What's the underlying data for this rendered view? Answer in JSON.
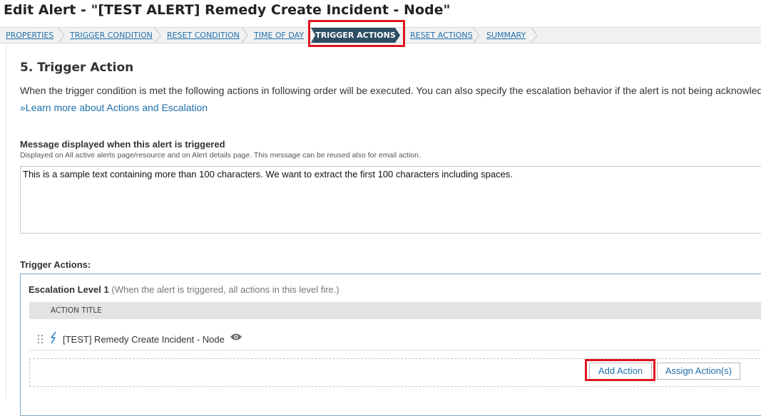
{
  "header": {
    "title": "Edit Alert - \"[TEST ALERT] Remedy Create Incident - Node\""
  },
  "wizard": {
    "steps": [
      "PROPERTIES",
      "TRIGGER CONDITION",
      "RESET CONDITION",
      "TIME OF DAY",
      "TRIGGER ACTIONS",
      "RESET ACTIONS",
      "SUMMARY"
    ],
    "active_step": "TRIGGER ACTIONS"
  },
  "section": {
    "title": "5. Trigger Action",
    "description": "When the trigger condition is met the following actions in following order will be executed. You can also specify the escalation behavior if the alert is not being acknowledged",
    "learn_more_link": "»Learn more about Actions and Escalation"
  },
  "message": {
    "label": "Message displayed when this alert is triggered",
    "help": "Displayed on All active alerts page/resource and on Alert details page. This message can be reused also for email action.",
    "value": "This is a sample text containing more than 100 characters. We want to extract the first 100 characters including spaces."
  },
  "trigger_actions": {
    "label": "Trigger Actions:",
    "escalation_level": "Escalation Level 1",
    "escalation_note": "(When the alert is triggered, all actions in this level fire.)",
    "column_header": "ACTION TITLE",
    "actions": [
      {
        "title": "[TEST] Remedy Create Incident - Node",
        "icon": "lightning-bolt-icon"
      }
    ],
    "add_action_label": "Add Action",
    "assign_action_label": "Assign Action(s)"
  },
  "colors": {
    "link": "#1f6fab",
    "active_step_bg": "#2e4e63",
    "highlight": "#e0141f",
    "escalation_border": "#7aa7c7"
  }
}
